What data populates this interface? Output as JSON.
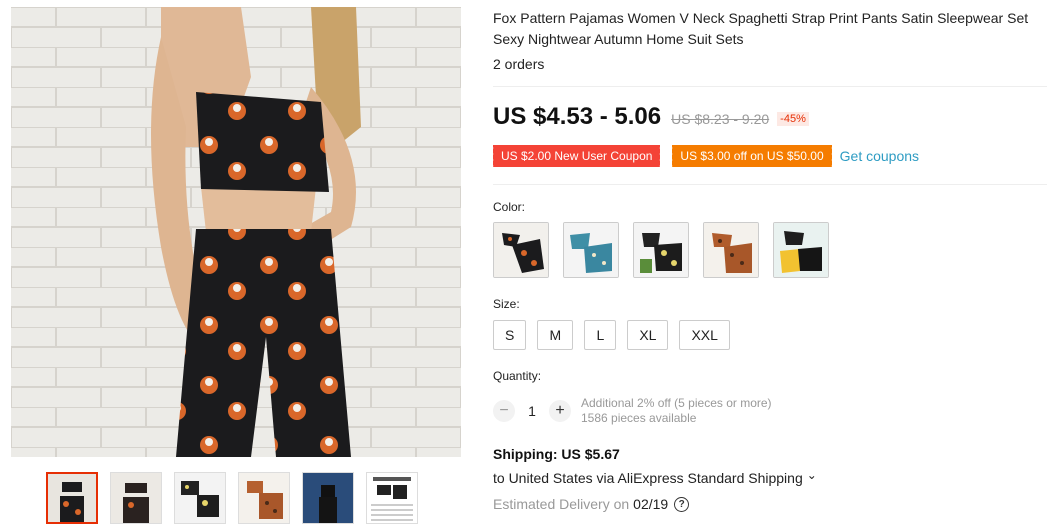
{
  "product": {
    "title": "Fox Pattern Pajamas Women V Neck Spaghetti Strap Print Pants Satin Sleepwear Set Sexy Nightwear Autumn Home Suit Sets",
    "orders": "2 orders"
  },
  "price": {
    "current": "US $4.53 - 5.06",
    "original": "US $8.23 - 9.20",
    "discount": "-45%"
  },
  "coupons": {
    "new_user": "US $2.00 New User Coupon",
    "store": "US $3.00 off on US $50.00",
    "get_label": "Get coupons"
  },
  "color": {
    "label": "Color:",
    "swatch_icons": [
      "fox-print-set",
      "blue-print-set",
      "black-print-set",
      "leopard-print-set",
      "black-yellow-set"
    ]
  },
  "size": {
    "label": "Size:",
    "options": [
      "S",
      "M",
      "L",
      "XL",
      "XXL"
    ]
  },
  "quantity": {
    "label": "Quantity:",
    "value": "1",
    "minus": "−",
    "plus": "+",
    "additional": "Additional 2% off (5 pieces or more)",
    "available": "1586 pieces available"
  },
  "shipping": {
    "title": "Shipping: US $5.67",
    "line": "to United States via AliExpress Standard Shipping",
    "chevron": "⌄",
    "delivery_label": "Estimated Delivery on",
    "delivery_date": "02/19",
    "help_glyph": "?"
  },
  "gallery": {
    "thumb_count": 6,
    "selected_index": 0
  },
  "colors": {
    "accent_red": "#e62e04",
    "coupon_red": "#f44336",
    "coupon_orange": "#f57c00",
    "link_blue": "#2e9cc3"
  }
}
